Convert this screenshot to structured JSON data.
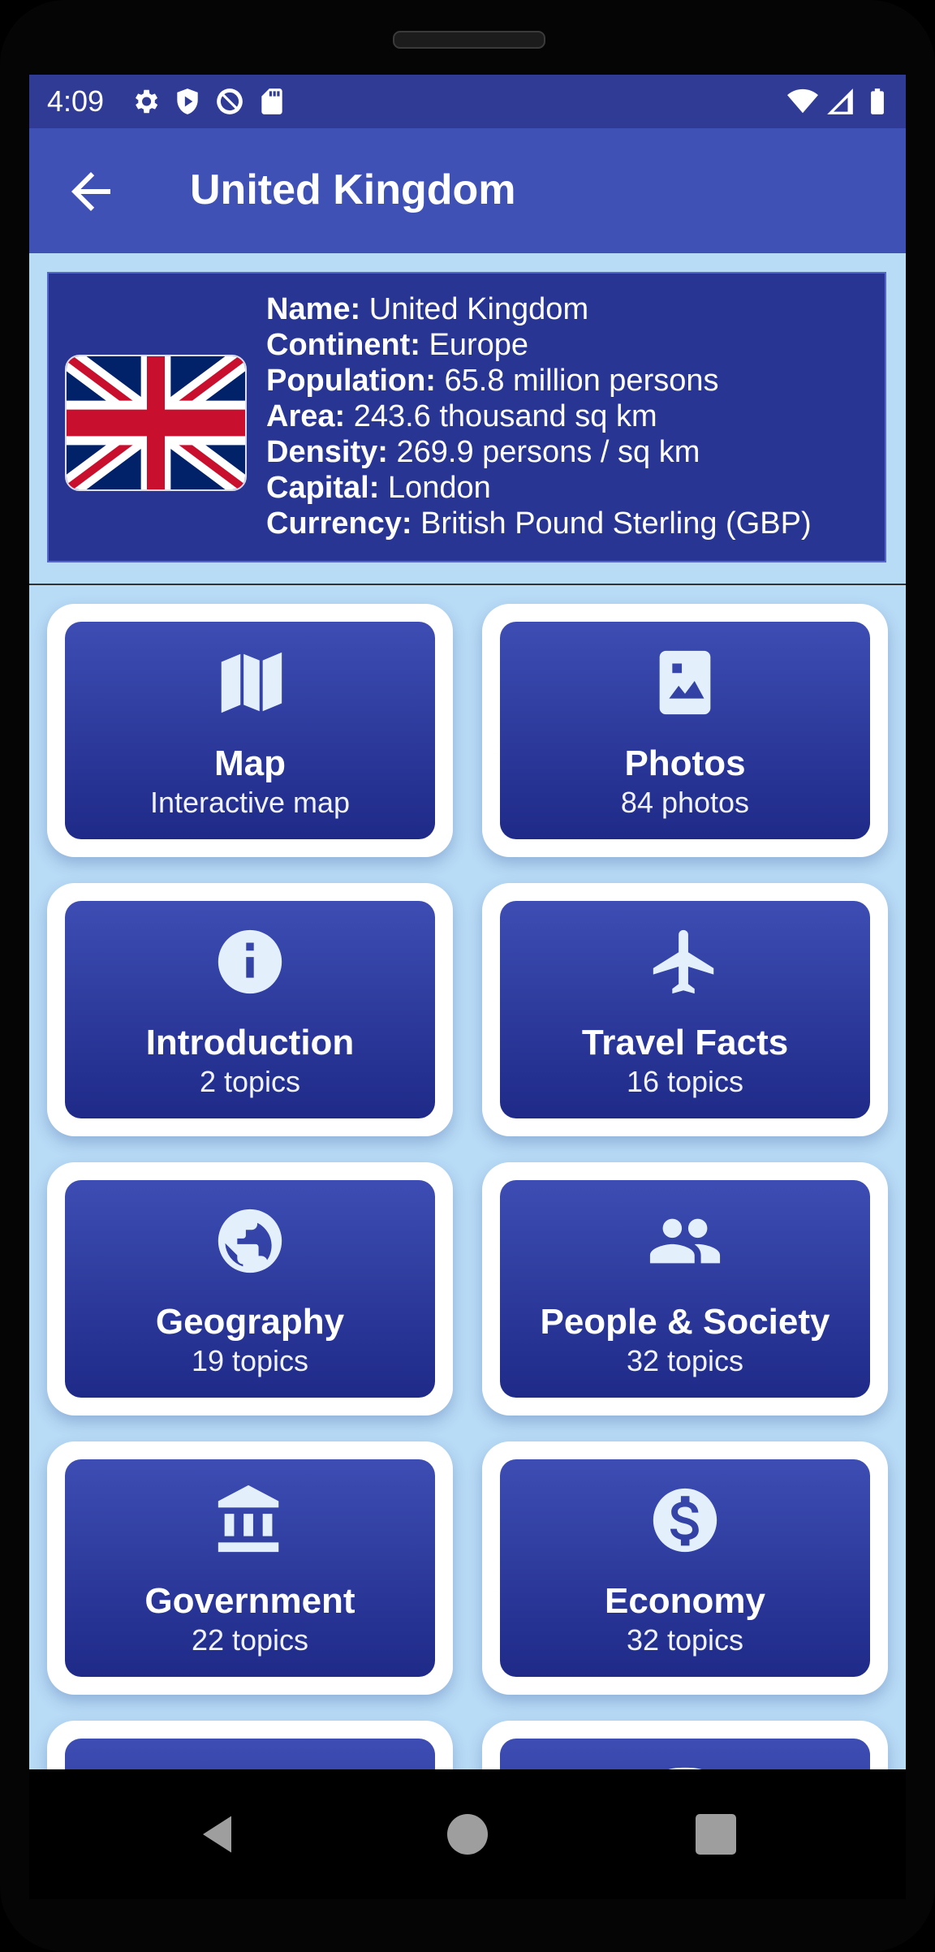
{
  "status_bar": {
    "time": "4:09",
    "left_icons": [
      "gear-icon",
      "shield-play-icon",
      "at-sign-icon",
      "sd-card-icon"
    ],
    "right_icons": [
      "wifi-icon",
      "signal-icon",
      "battery-icon"
    ]
  },
  "app_bar": {
    "title": "United Kingdom",
    "back_icon": "arrow-back-icon"
  },
  "country": {
    "flag": "uk-flag",
    "facts": [
      {
        "label": "Name:",
        "value": "United Kingdom"
      },
      {
        "label": "Continent:",
        "value": "Europe"
      },
      {
        "label": "Population:",
        "value": "65.8 million persons"
      },
      {
        "label": "Area:",
        "value": "243.6 thousand sq km"
      },
      {
        "label": "Density:",
        "value": "269.9 persons / sq km"
      },
      {
        "label": "Capital:",
        "value": "London"
      },
      {
        "label": "Currency:",
        "value": "British Pound Sterling (GBP)"
      }
    ]
  },
  "tiles": [
    {
      "title": "Map",
      "subtitle": "Interactive map",
      "icon": "map-icon"
    },
    {
      "title": "Photos",
      "subtitle": "84 photos",
      "icon": "photo-icon"
    },
    {
      "title": "Introduction",
      "subtitle": "2 topics",
      "icon": "info-icon"
    },
    {
      "title": "Travel Facts",
      "subtitle": "16 topics",
      "icon": "airplane-icon"
    },
    {
      "title": "Geography",
      "subtitle": "19 topics",
      "icon": "globe-icon"
    },
    {
      "title": "People & Society",
      "subtitle": "32 topics",
      "icon": "people-icon"
    },
    {
      "title": "Government",
      "subtitle": "22 topics",
      "icon": "bank-icon"
    },
    {
      "title": "Economy",
      "subtitle": "32 topics",
      "icon": "dollar-icon"
    },
    {
      "title": "",
      "subtitle": "",
      "icon": "chart-icon"
    },
    {
      "title": "",
      "subtitle": "",
      "icon": "vehicle-icon"
    }
  ],
  "colors": {
    "app_bar": "#3f51b5",
    "status_bar": "#2f3b95",
    "panel": "#283593",
    "background": "#b8dbf6",
    "tile_top": "#3d4db3",
    "tile_bottom": "#1f2a88"
  },
  "nav_bar": {
    "buttons": [
      "nav-back-icon",
      "nav-home-icon",
      "nav-recents-icon"
    ]
  }
}
